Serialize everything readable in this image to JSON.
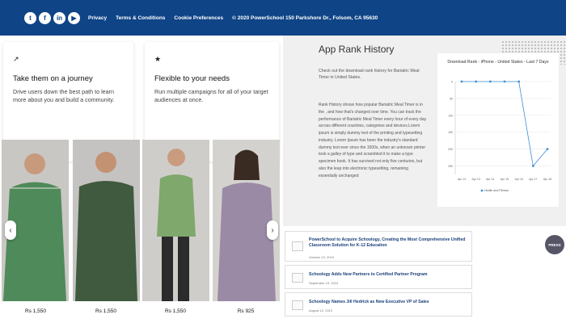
{
  "topbar": {
    "social_icons": [
      "twitter-icon",
      "facebook-icon",
      "linkedin-icon",
      "youtube-icon"
    ],
    "social_glyphs": [
      "t",
      "f",
      "in",
      "▶"
    ],
    "links": [
      "Privacy",
      "Terms & Conditions",
      "Cookie Preferences",
      "© 2020 PowerSchool 150 Parkshore Dr., Folsom, CA 95630"
    ],
    "bg_color": "#0f4486"
  },
  "features": [
    {
      "icon": "trend-up-icon",
      "glyph": "↗",
      "title": "Take them on a journey",
      "text": "Drive users down the best path to learn more about you and build a community."
    },
    {
      "icon": "star-icon",
      "glyph": "★",
      "title": "Flexible to your needs",
      "text": "Run multiple campaigns for all of your target audiences at once."
    }
  ],
  "products": [
    {
      "price": "Rs 1,550",
      "shirt": "#4f8a5a"
    },
    {
      "price": "Rs 1,550",
      "shirt": "#3f5a3e"
    },
    {
      "price": "Rs 1,550",
      "shirt": "#7fa86c"
    },
    {
      "price": "Rs 925",
      "shirt": "#9b8aa6"
    }
  ],
  "carousel": {
    "prev": "‹",
    "next": "›"
  },
  "app_rank": {
    "title": "App Rank History",
    "intro": "Check out the download rank history for Bariatric Meal Timer in United States.",
    "body": "Rank History shows how popular Bariatric Meal Timer is in the , and how that's changed over time. You can track the performance of Bariatric Meal Timer every hour of every day across different countries, categories and devices.Lorem ipsum is simply dummy text of the printing and typesetting industry. Lorem Ipsum has been the industry's standard dummy text ever since the 1500s, when an unknown printer took a galley of type and scrambled it to make a type specimen book. It has survived not only five centuries, but also the leap into electronic typesetting, remaining essentially unchanged"
  },
  "chart_data": {
    "type": "line",
    "title": "Download Rank - iPhone - United States - Last 7 Days",
    "categories": [
      "Apr 12",
      "Apr 13",
      "Apr 14",
      "Apr 15",
      "Apr 16",
      "Apr 17",
      "Apr 18"
    ],
    "series": [
      {
        "name": "Health and Fitness",
        "values": [
          0,
          0,
          0,
          0,
          0,
          250,
          200
        ]
      }
    ],
    "yticks": [
      "0",
      "50",
      "100",
      "150",
      "200",
      "250"
    ],
    "ylim": [
      0,
      275
    ],
    "y_inverted": true,
    "line_color": "#3c8fd8",
    "grid": true,
    "legend_position": "bottom"
  },
  "news": [
    {
      "title": "PowerSchool to Acquire Schoology, Creating the Most Comprehensive Unified Classroom Solution for K-12 Education",
      "date": "October 24, 2019"
    },
    {
      "title": "Schoology Adds New Partners to Certified Partner Program",
      "date": "September 19, 2019"
    },
    {
      "title": "Schoology Names Jill Hedrick as New Executive VP of Sales",
      "date": "August 12, 2019"
    }
  ],
  "press_label": "PRESS"
}
